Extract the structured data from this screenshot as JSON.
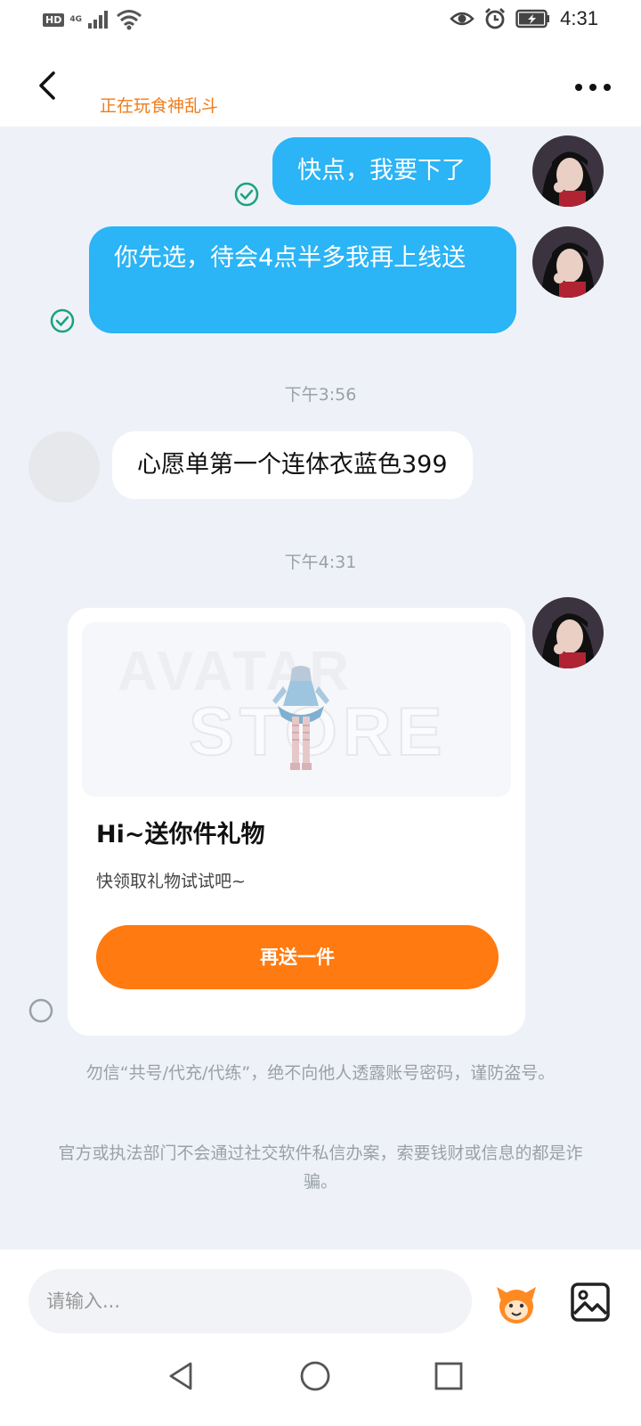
{
  "status_bar": {
    "hd": "HD",
    "network": "4G",
    "time": "4:31"
  },
  "header": {
    "subtitle": "正在玩食神乱斗",
    "icons": [
      "back-arrow-icon",
      "more-dots-icon"
    ]
  },
  "messages": [
    {
      "direction": "out",
      "text": "快点，我要下了",
      "status": "read"
    },
    {
      "direction": "out",
      "text": "你先选，待会4点半多我再上线送",
      "status": "read"
    },
    {
      "type": "timestamp",
      "text": "下午3:56"
    },
    {
      "direction": "in",
      "text": "心愿单第一个连体衣蓝色399"
    },
    {
      "type": "timestamp",
      "text": "下午4:31"
    }
  ],
  "gift_card": {
    "title": "Hi~送你件礼物",
    "subtitle": "快领取礼物试试吧~",
    "button": "再送一件",
    "watermark_line1": "AVATAR",
    "watermark_line2": "STORE"
  },
  "notices": [
    "勿信“共号/代充/代练”，绝不向他人透露账号密码，谨防盗号。",
    "官方或执法部门不会通过社交软件私信办案，索要钱财或信息的都是诈骗。"
  ],
  "input": {
    "placeholder": "请输入..."
  },
  "colors": {
    "accent_blue": "#2bb4f6",
    "accent_orange": "#ff7a10",
    "subtitle_orange": "#f07c1a",
    "chat_bg": "#eef2f8",
    "check_green": "#1aa37a"
  }
}
